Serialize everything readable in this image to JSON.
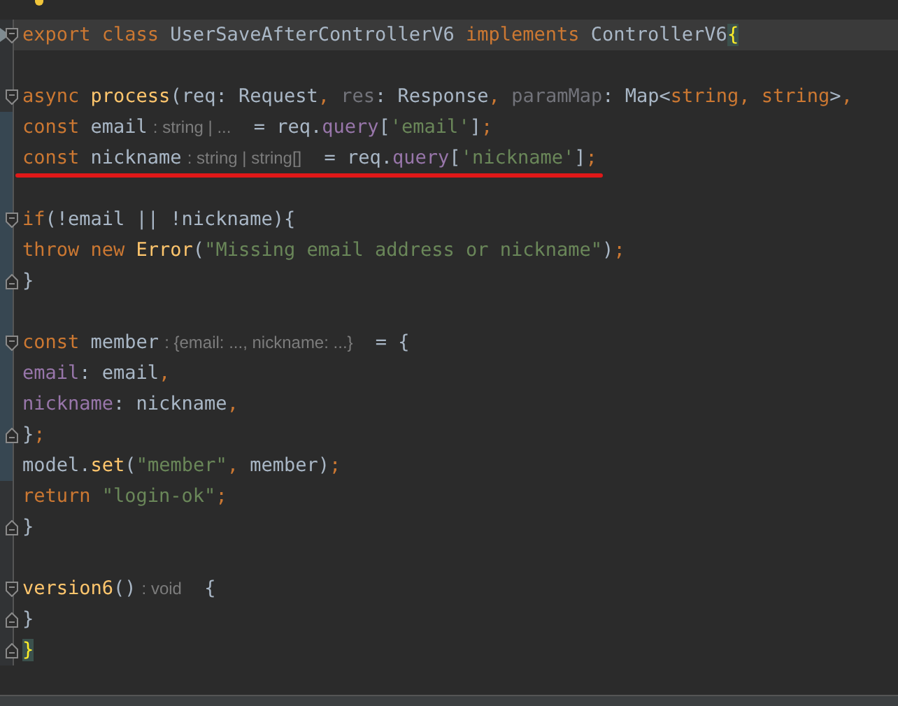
{
  "editor": {
    "lines": [
      {
        "fold_start": true,
        "fold_end": false,
        "current": true,
        "changed": false,
        "underlined": false,
        "tokens": [
          {
            "kind": "kw",
            "text": "export class "
          },
          {
            "kind": "plain",
            "text": "UserSaveAfterControllerV6 "
          },
          {
            "kind": "kw",
            "text": "implements "
          },
          {
            "kind": "plain",
            "text": "ControllerV6"
          },
          {
            "kind": "match",
            "text": "{"
          }
        ]
      },
      {
        "fold_start": false,
        "fold_end": false,
        "current": false,
        "changed": false,
        "underlined": false
      },
      {
        "fold_start": true,
        "fold_end": false,
        "current": false,
        "changed": false,
        "underlined": false,
        "tokens": [
          {
            "kind": "kw",
            "text": "    async "
          },
          {
            "kind": "fn",
            "text": "process"
          },
          {
            "kind": "plain",
            "text": "(req: Request"
          },
          {
            "kind": "kw",
            "text": ", "
          },
          {
            "kind": "muted",
            "text": "res"
          },
          {
            "kind": "plain",
            "text": ": Response"
          },
          {
            "kind": "kw",
            "text": ", "
          },
          {
            "kind": "muted",
            "text": "paramMap"
          },
          {
            "kind": "plain",
            "text": ": Map<"
          },
          {
            "kind": "kw",
            "text": "string, string"
          },
          {
            "kind": "plain",
            "text": ">"
          },
          {
            "kind": "kw",
            "text": ", "
          }
        ]
      },
      {
        "fold_start": false,
        "fold_end": false,
        "current": false,
        "changed": true,
        "underlined": false,
        "tokens": [
          {
            "kind": "kw",
            "text": "        const "
          },
          {
            "kind": "plain",
            "text": "email"
          },
          {
            "kind": "hint",
            "text": ": string | ..."
          },
          {
            "kind": "plain",
            "text": " = req."
          },
          {
            "kind": "prop",
            "text": "query"
          },
          {
            "kind": "plain",
            "text": "["
          },
          {
            "kind": "str",
            "text": "'email'"
          },
          {
            "kind": "plain",
            "text": "]"
          },
          {
            "kind": "kw",
            "text": ";"
          }
        ]
      },
      {
        "fold_start": false,
        "fold_end": false,
        "current": false,
        "changed": true,
        "underlined": true,
        "tokens": [
          {
            "kind": "kw",
            "text": "        const "
          },
          {
            "kind": "plain",
            "text": "nickname"
          },
          {
            "kind": "hint",
            "text": ": string | string[]"
          },
          {
            "kind": "plain",
            "text": " = req."
          },
          {
            "kind": "prop",
            "text": "query"
          },
          {
            "kind": "plain",
            "text": "["
          },
          {
            "kind": "str",
            "text": "'nickname'"
          },
          {
            "kind": "plain",
            "text": "]"
          },
          {
            "kind": "kw",
            "text": ";"
          }
        ]
      },
      {
        "fold_start": false,
        "fold_end": false,
        "current": false,
        "changed": true,
        "underlined": false
      },
      {
        "fold_start": true,
        "fold_end": false,
        "current": false,
        "changed": true,
        "underlined": false,
        "tokens": [
          {
            "kind": "kw",
            "text": "        if"
          },
          {
            "kind": "plain",
            "text": "(!email || !nickname){"
          }
        ]
      },
      {
        "fold_start": false,
        "fold_end": false,
        "current": false,
        "changed": true,
        "underlined": false,
        "tokens": [
          {
            "kind": "kw",
            "text": "            throw new "
          },
          {
            "kind": "fn",
            "text": "Error"
          },
          {
            "kind": "plain",
            "text": "("
          },
          {
            "kind": "str",
            "text": "\"Missing email address or nickname\""
          },
          {
            "kind": "plain",
            "text": ")"
          },
          {
            "kind": "kw",
            "text": ";"
          }
        ]
      },
      {
        "fold_start": false,
        "fold_end": true,
        "current": false,
        "changed": true,
        "underlined": false,
        "tokens": [
          {
            "kind": "plain",
            "text": "        }"
          }
        ]
      },
      {
        "fold_start": false,
        "fold_end": false,
        "current": false,
        "changed": true,
        "underlined": false
      },
      {
        "fold_start": true,
        "fold_end": false,
        "current": false,
        "changed": true,
        "underlined": false,
        "tokens": [
          {
            "kind": "kw",
            "text": "        const "
          },
          {
            "kind": "plain",
            "text": "member"
          },
          {
            "kind": "hint",
            "text": ": {email: ..., nickname: ...}"
          },
          {
            "kind": "plain",
            "text": " = {"
          }
        ]
      },
      {
        "fold_start": false,
        "fold_end": false,
        "current": false,
        "changed": true,
        "underlined": false,
        "tokens": [
          {
            "kind": "prop",
            "text": "            email"
          },
          {
            "kind": "plain",
            "text": ": email"
          },
          {
            "kind": "kw",
            "text": ","
          }
        ]
      },
      {
        "fold_start": false,
        "fold_end": false,
        "current": false,
        "changed": true,
        "underlined": false,
        "tokens": [
          {
            "kind": "prop",
            "text": "            nickname"
          },
          {
            "kind": "plain",
            "text": ": nickname"
          },
          {
            "kind": "kw",
            "text": ","
          }
        ]
      },
      {
        "fold_start": false,
        "fold_end": true,
        "current": false,
        "changed": true,
        "underlined": false,
        "tokens": [
          {
            "kind": "plain",
            "text": "        }"
          },
          {
            "kind": "kw",
            "text": ";"
          }
        ]
      },
      {
        "fold_start": false,
        "fold_end": false,
        "current": false,
        "changed": true,
        "underlined": false,
        "tokens": [
          {
            "kind": "plain",
            "text": "        model."
          },
          {
            "kind": "fn",
            "text": "set"
          },
          {
            "kind": "plain",
            "text": "("
          },
          {
            "kind": "str",
            "text": "\"member\""
          },
          {
            "kind": "kw",
            "text": ", "
          },
          {
            "kind": "plain",
            "text": "member)"
          },
          {
            "kind": "kw",
            "text": ";"
          }
        ]
      },
      {
        "fold_start": false,
        "fold_end": false,
        "current": false,
        "changed": false,
        "underlined": false,
        "tokens": [
          {
            "kind": "kw",
            "text": "        return "
          },
          {
            "kind": "str",
            "text": "\"login-ok\""
          },
          {
            "kind": "kw",
            "text": ";"
          }
        ]
      },
      {
        "fold_start": false,
        "fold_end": true,
        "current": false,
        "changed": false,
        "underlined": false,
        "tokens": [
          {
            "kind": "plain",
            "text": "    }"
          }
        ]
      },
      {
        "fold_start": false,
        "fold_end": false,
        "current": false,
        "changed": false,
        "underlined": false
      },
      {
        "fold_start": true,
        "fold_end": false,
        "current": false,
        "changed": false,
        "underlined": false,
        "tokens": [
          {
            "kind": "fn",
            "text": "    version6"
          },
          {
            "kind": "plain",
            "text": "()"
          },
          {
            "kind": "hint",
            "text": ": void"
          },
          {
            "kind": "plain",
            "text": " {"
          }
        ]
      },
      {
        "fold_start": false,
        "fold_end": true,
        "current": false,
        "changed": false,
        "underlined": false,
        "tokens": [
          {
            "kind": "plain",
            "text": "    }"
          }
        ]
      },
      {
        "fold_start": false,
        "fold_end": true,
        "current": false,
        "changed": false,
        "underlined": false,
        "tokens": [
          {
            "kind": "match",
            "text": "}"
          }
        ]
      }
    ]
  }
}
